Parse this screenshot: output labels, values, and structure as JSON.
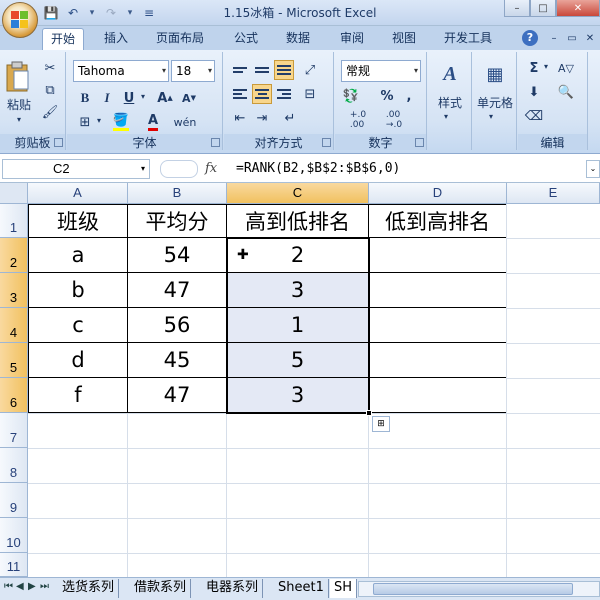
{
  "window": {
    "title": "1.15冰箱 - Microsoft Excel",
    "controls": [
      "–",
      "□",
      "✕"
    ]
  },
  "qat": {
    "icons": [
      "save-icon",
      "undo-icon",
      "redo-icon",
      "customize-icon"
    ]
  },
  "ribbon": {
    "tabs": [
      "开始",
      "插入",
      "页面布局",
      "公式",
      "数据",
      "审阅",
      "视图",
      "开发工具"
    ],
    "active_tab": "开始",
    "groups": {
      "clipboard": {
        "label": "剪贴板",
        "paste_label": "粘贴"
      },
      "font": {
        "label": "字体",
        "font_name": "Tahoma",
        "font_size": "18"
      },
      "alignment": {
        "label": "对齐方式"
      },
      "number": {
        "label": "数字",
        "format": "常规"
      },
      "styles": {
        "label": "样式"
      },
      "cells": {
        "label": "单元格"
      },
      "editing": {
        "label": "编辑"
      }
    }
  },
  "formula_bar": {
    "name_box": "C2",
    "fx": "fx",
    "formula": "=RANK(B2,$B$2:$B$6,0)"
  },
  "grid": {
    "columns": [
      "A",
      "B",
      "C",
      "D",
      "E"
    ],
    "rows": [
      "1",
      "2",
      "3",
      "4",
      "5",
      "6",
      "7",
      "8",
      "9",
      "10",
      "11"
    ],
    "selected_column": "C",
    "selected_rows": [
      "2",
      "3",
      "4",
      "5",
      "6"
    ],
    "headers": [
      "班级",
      "平均分",
      "高到低排名",
      "低到高排名"
    ],
    "data": [
      [
        "a",
        "54",
        "2",
        ""
      ],
      [
        "b",
        "47",
        "3",
        ""
      ],
      [
        "c",
        "56",
        "1",
        ""
      ],
      [
        "d",
        "45",
        "5",
        ""
      ],
      [
        "f",
        "47",
        "3",
        ""
      ]
    ]
  },
  "sheets": {
    "tabs": [
      "选货系列",
      "借款系列",
      "电器系列",
      "Sheet1",
      "SH"
    ]
  },
  "colors": {
    "selection_header": "#f1c15f",
    "selected_cells": "#e4e9f5",
    "ribbon": "#d5e3f4"
  }
}
